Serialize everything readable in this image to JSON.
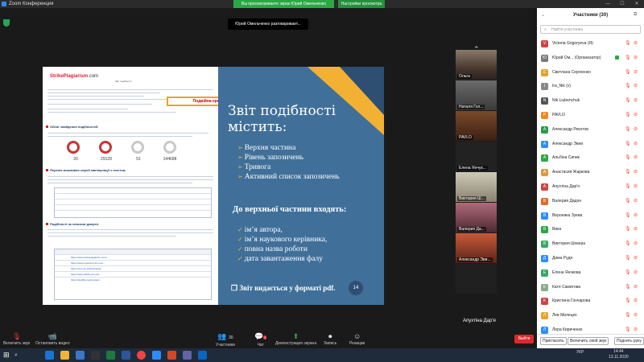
{
  "window": {
    "title": "Zoom Конференция",
    "controls": [
      "—",
      "☐",
      "✕"
    ]
  },
  "share_banner": {
    "text": "Вы просматриваете экран Юрий Омельченко",
    "view_options": "Настройки просмотра"
  },
  "speaker": "Юрий Омельченко разговаривает...",
  "shared_doc": {
    "logo": "StrikePlagiarism",
    "logo_suffix": ".com",
    "header": "Звіт подібності",
    "warning": "Подвійна ерф-анз-от сумністо",
    "sections": [
      "Обсяг знайдених подібностей",
      "Перелік можливих спроб маніпуляції з текстом",
      "Подібності за списком джерел"
    ],
    "stats": [
      "20",
      "29129",
      "51",
      "144698"
    ],
    "links": [
      "https://www.strikeplagiarism.com/...",
      "https://www.repository.knu.ua/...",
      "https://core.ac.uk/download/...",
      "https://www.ukrlib.com.ua/...",
      "https://studfile.net/preview/..."
    ]
  },
  "slide": {
    "title": "Звіт подібності містить:",
    "bullets": [
      "Верхня частина",
      "Рівень запозичень",
      "Тривога",
      "Активний список запозичень"
    ],
    "subtitle": "До верхньої частини входять:",
    "checks": [
      "ім’я автора,",
      "ім’я наукового керівника,",
      "повна назва роботи",
      "дата завантаження фалу"
    ],
    "footer": "Звіт видається у форматі pdf.",
    "page": "14"
  },
  "thumbnails": [
    {
      "name": "Ольга"
    },
    {
      "name": "Наталя Гол..."
    },
    {
      "name": "PAVLO"
    },
    {
      "name": "Елена Янчук..."
    },
    {
      "name": "Виктория Ш..."
    },
    {
      "name": "Валерия Дa..."
    },
    {
      "name": "Александр Эви..."
    }
  ],
  "self_label": "Апухтіна Дар'я",
  "toolbar": {
    "mute": "Включить звук",
    "video": "Остановить видео",
    "participants": "Участники",
    "participants_count": "30",
    "chat": "Чат",
    "chat_badge": "1",
    "share": "Демонстрация экрана",
    "record": "Запись",
    "reactions": "Реакции",
    "end": "Выйти"
  },
  "participants": {
    "title": "Участники (30)",
    "search_placeholder": "Найти участника",
    "list": [
      {
        "name": "Victoria Grigoryeva (Я)",
        "initial": "V",
        "color": "#c44"
      },
      {
        "name": "Юрий Ом... (Организатор)",
        "initial": "Ю",
        "color": "#777"
      },
      {
        "name": "Светлана Сергеенко",
        "initial": "С",
        "color": "#e8a22c"
      },
      {
        "name": "Ira_Nik (v)",
        "initial": "I",
        "color": "#888"
      },
      {
        "name": "Nik Liubenchuk",
        "initial": "N",
        "color": "#555"
      },
      {
        "name": "PAVLO",
        "initial": "P",
        "color": "#f0891e"
      },
      {
        "name": "Александр Рекотов",
        "initial": "А",
        "color": "#2a9a4a"
      },
      {
        "name": "Александр Эвни",
        "initial": "А",
        "color": "#2d8cff"
      },
      {
        "name": "Альбіна Сипик",
        "initial": "А",
        "color": "#2aa845"
      },
      {
        "name": "Анастасия Жаркова",
        "initial": "А",
        "color": "#d94"
      },
      {
        "name": "Апухтіна Дар'я",
        "initial": "А",
        "color": "#c44"
      },
      {
        "name": "Валерия Дадон",
        "initial": "В",
        "color": "#e06a2c"
      },
      {
        "name": "Вероника Зуева",
        "initial": "В",
        "color": "#2d8cff"
      },
      {
        "name": "Вика",
        "initial": "В",
        "color": "#2aa845"
      },
      {
        "name": "Виктория Шокера",
        "initial": "В",
        "color": "#3a6"
      },
      {
        "name": "Дима Рудя",
        "initial": "Д",
        "color": "#2d8cff"
      },
      {
        "name": "Елена Янчкова",
        "initial": "Е",
        "color": "#3a6"
      },
      {
        "name": "Катя Самитова",
        "initial": "К",
        "color": "#8a8"
      },
      {
        "name": "Кристина Гончарова",
        "initial": "К",
        "color": "#c44"
      },
      {
        "name": "Лев Милецко",
        "initial": "Л",
        "color": "#e8a22c"
      },
      {
        "name": "Лера Кириченко",
        "initial": "Л",
        "color": "#2d8cff"
      }
    ],
    "footer": {
      "invite": "Пригласить",
      "unmute_me": "Включить свой звук",
      "raise_hand": "Поднять руку"
    }
  },
  "taskbar": {
    "lang": "УКР",
    "time": "14:44",
    "date": "13.11.2020"
  }
}
